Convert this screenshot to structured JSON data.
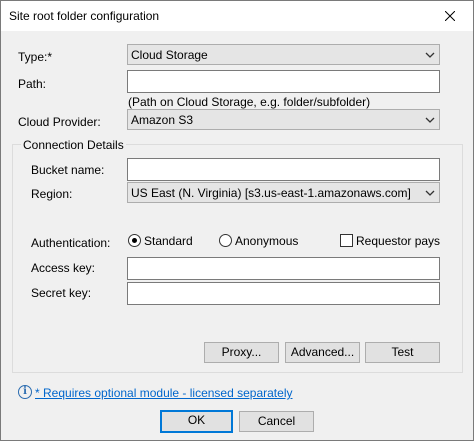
{
  "window": {
    "title": "Site root folder configuration",
    "close_glyph": "✕"
  },
  "form": {
    "type_label": "Type:*",
    "type_value": "Cloud Storage",
    "path_label": "Path:",
    "path_value": "",
    "path_hint": "(Path on Cloud Storage, e.g. folder/subfolder)",
    "provider_label": "Cloud Provider:",
    "provider_value": "Amazon S3"
  },
  "connection": {
    "group_title": "Connection Details",
    "bucket_label": "Bucket name:",
    "bucket_value": "",
    "region_label": "Region:",
    "region_value": "US East (N. Virginia) [s3.us-east-1.amazonaws.com]",
    "auth_label": "Authentication:",
    "auth_standard": "Standard",
    "auth_anonymous": "Anonymous",
    "auth_selected": "Standard",
    "requestor_pays_label": "Requestor pays",
    "requestor_pays_checked": false,
    "access_key_label": "Access key:",
    "access_key_value": "",
    "secret_key_label": "Secret key:",
    "secret_key_value": "",
    "proxy_button": "Proxy...",
    "advanced_button": "Advanced...",
    "test_button": "Test"
  },
  "footer": {
    "info_icon_glyph": "i",
    "module_link": "* Requires optional module - licensed separately",
    "ok_button": "OK",
    "cancel_button": "Cancel"
  },
  "icons": {
    "close": "close-icon",
    "dropdown": "chevron-down-icon",
    "info": "info-icon"
  },
  "colors": {
    "accent": "#0078d7",
    "link": "#0066cc",
    "background": "#f0f0f0"
  }
}
